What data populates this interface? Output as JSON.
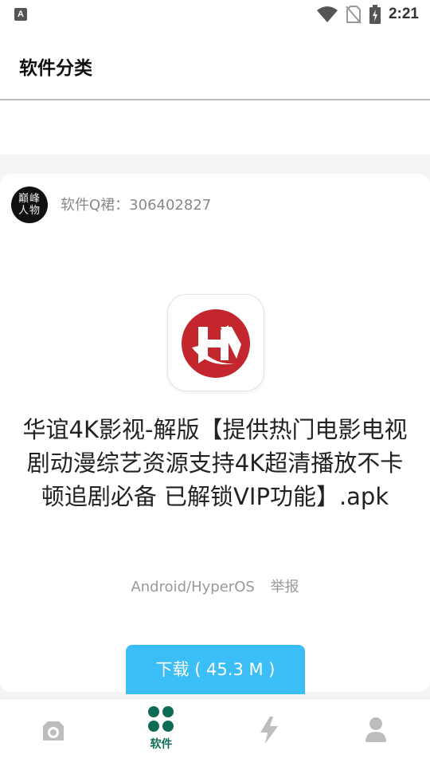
{
  "status_bar": {
    "time": "2:21",
    "notification_icon": "a-keyboard-icon",
    "wifi_icon": "wifi-icon",
    "sim_icon": "no-sim-icon",
    "battery_icon": "battery-charging-icon"
  },
  "header": {
    "title": "软件分类"
  },
  "post": {
    "avatar_text_top": "巅峰",
    "avatar_text_bottom": "人物",
    "uploader_info": "软件Q裙：306402827",
    "app_title": "华谊4K影视-解版【提供热门电影电视剧动漫综艺资源支持4K超清播放不卡顿追剧必备 已解锁VIP功能】.apk",
    "platform": "Android/HyperOS",
    "report_label": "举报",
    "download_label": "下载 ( 45.3 M )",
    "brand_color": "#c4262e"
  },
  "tabbar": {
    "tabs": [
      {
        "icon": "camera-icon",
        "label": "",
        "active": false
      },
      {
        "icon": "grid-icon",
        "label": "软件",
        "active": true
      },
      {
        "icon": "lightning-icon",
        "label": "",
        "active": false
      },
      {
        "icon": "person-icon",
        "label": "",
        "active": false
      }
    ],
    "active_color": "#0f6b55",
    "inactive_color": "#bdbdbd"
  }
}
